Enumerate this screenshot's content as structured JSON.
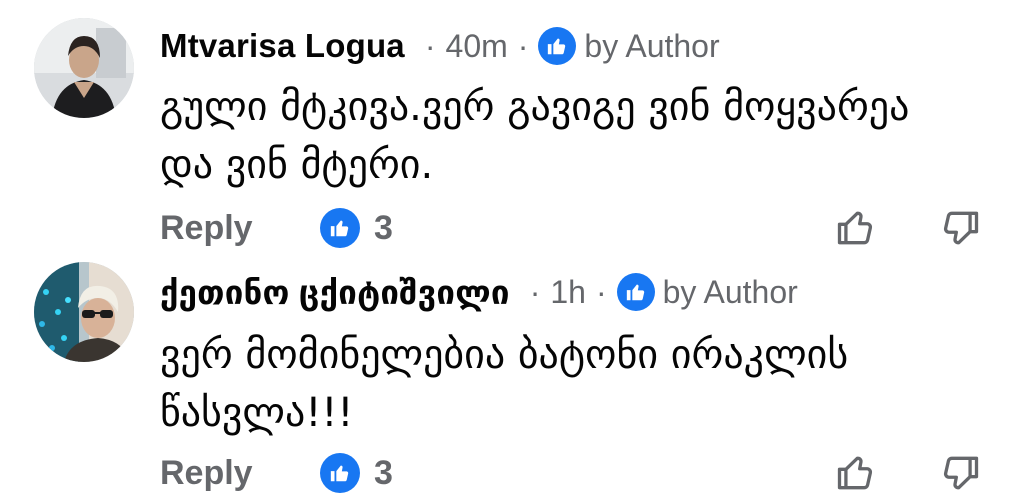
{
  "comments": [
    {
      "author": "Mtvarisa Logua",
      "time": "40m",
      "separator": "·",
      "badge_label": "by Author",
      "text": "გული მტკივა.ვერ გავიგე ვინ მოყვარეა და ვინ მტერი.",
      "reply_label": "Reply",
      "like_count": "3"
    },
    {
      "author": "ქეთინო ცქიტიშვილი",
      "time": "1h",
      "separator": "·",
      "badge_label": "by Author",
      "text": "ვერ მომინელებია ბატონი ირაკლის წასვლა!!!",
      "reply_label": "Reply",
      "like_count": "3"
    }
  ],
  "icons": {
    "like_badge": "thumbs-up-icon",
    "upvote": "thumbs-up-outline-icon",
    "downvote": "thumbs-down-outline-icon"
  },
  "colors": {
    "accent": "#1877f2",
    "secondary_text": "#65676b",
    "primary_text": "#050505"
  }
}
